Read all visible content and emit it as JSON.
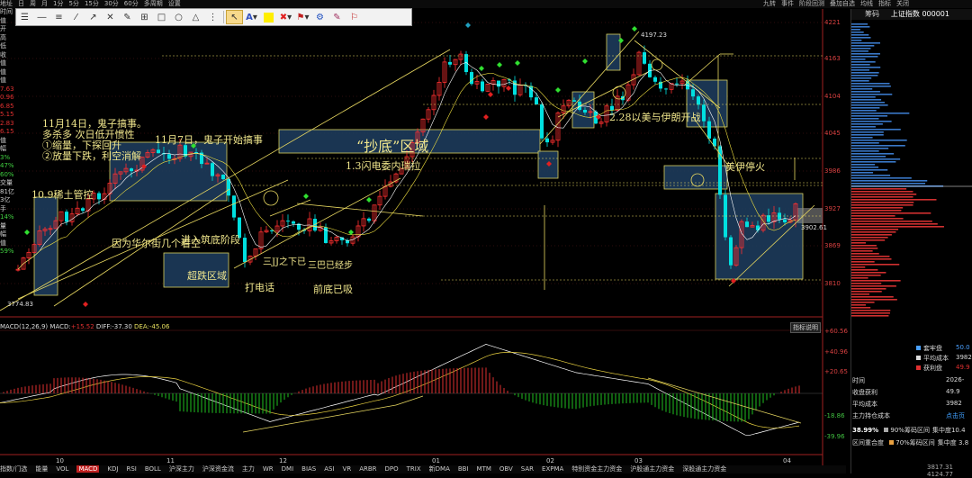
{
  "menubar": {
    "left_items": [
      "地址",
      "日",
      "周",
      "月",
      "1分",
      "5分",
      "15分",
      "30分",
      "60分",
      "多周期",
      "设置"
    ],
    "right_items": [
      "九转",
      "事件",
      "阶段回测",
      "叠加自选",
      "均线",
      "指标",
      "关闭"
    ]
  },
  "toolbar": {
    "icons": [
      "cursor",
      "text-A",
      "yellow-square",
      "red-x",
      "flag",
      "gear",
      "draw-tool"
    ],
    "cursor_selected": true
  },
  "left_panel": {
    "labels": [
      "时间",
      "值",
      "开",
      "高",
      "低",
      "收",
      "值",
      "值",
      "值",
      "7.63",
      "0.96",
      "6.85",
      "5.15",
      "2.83",
      "6.15",
      "值",
      "幅",
      "3%",
      "47%",
      "60%",
      "交量",
      "81亿",
      "3亿",
      "手",
      "14%",
      "量",
      "幅",
      "值",
      "59%"
    ]
  },
  "price_axis": {
    "labels": [
      "4221",
      "4163",
      "4104",
      "4045",
      "3986",
      "3927",
      "3869",
      "3810"
    ]
  },
  "price_tags": {
    "high": "4197.23",
    "low": "3774.83",
    "current": "3902.61"
  },
  "x_axis": {
    "labels": [
      "10",
      "11",
      "12",
      "01",
      "02",
      "03",
      "04"
    ]
  },
  "annotations": {
    "a1": "11月14日，鬼子搞事。",
    "a2": "多杀多   次日低开惯性",
    "a3": "①缩量，下探回升",
    "a4": "②放量下跌，利空消解",
    "a5": "11月7日，鬼子开始搞事",
    "a6": "10.9稀土管控",
    "a7": "“抄底”区域",
    "a8": "1.3闪电委内瑞拉",
    "a9": "2.28以美与伊朗开战",
    "a10": "美伊停火",
    "a11": "因为华尔街几个看空",
    "a12": "进入筑底阶段",
    "a13": "超跌区域",
    "a14": "打电话",
    "a15": "三JJ之下已",
    "a16": "三巴已经步",
    "a17": "前底已吸"
  },
  "macd": {
    "title": "MACD(12,26,9)",
    "macd_label": "MACD:",
    "macd_value": "+15.52",
    "diff_label": "DIFF:",
    "diff_value": "-37.30",
    "dea_label": "DEA:",
    "dea_value": "-45.06",
    "axis_labels": [
      "+60.56",
      "+40.96",
      "+20.65",
      "-18.86",
      "-39.96"
    ],
    "button": "指标说明"
  },
  "right_panel": {
    "title": "上证指数 000001",
    "sub": "筹码",
    "legend": [
      {
        "label": "套牢盘",
        "value": "50.0",
        "color": "#4aa0ff"
      },
      {
        "label": "平均成本",
        "value": "3982",
        "color": "#dddddd"
      },
      {
        "label": "获利盘",
        "value": "49.9",
        "color": "#e03030"
      }
    ],
    "stats": [
      {
        "label": "时间",
        "value": "2026-"
      },
      {
        "label": "收盘获利",
        "value": "49.9"
      },
      {
        "label": "平均成本",
        "value": "3982"
      },
      {
        "label": "主力持仓成本",
        "value": "点击页"
      }
    ],
    "chip90": {
      "pct": "38.99%",
      "label": "90%筹码区间",
      "conc": "集中度10.4"
    },
    "chip70": {
      "pct": "",
      "label": "70%筹码区间",
      "conc": "集中度 3.8"
    },
    "bottom": "3817.31  4124.77"
  },
  "bottom_tabs": {
    "items": [
      "指数/门选",
      "能量",
      "VOL",
      "MACD",
      "KDJ",
      "RSI",
      "BOLL",
      "沪深主力",
      "沪深资金流",
      "主力",
      "WR",
      "DMI",
      "BIAS",
      "ASI",
      "VR",
      "ARBR",
      "DPO",
      "TRIX",
      "新DMA",
      "BBI",
      "MTM",
      "OBV",
      "SAR",
      "EXPMA",
      "特别资金主力资金",
      "沪股通主力资金",
      "深股通主力资金"
    ],
    "active": "MACD"
  }
}
